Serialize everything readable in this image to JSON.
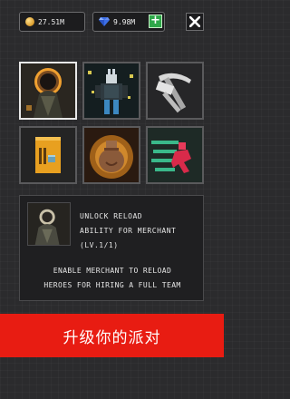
{
  "currency": {
    "coins": "27.51M",
    "gems": "9.98M",
    "add_gems_label": "+",
    "coin_color": "#e2a332",
    "gem_color": "#3d6fe6"
  },
  "upgrade": {
    "title": "UNLOCK RELOAD\nABILITY FOR MERCHANT\n(LV.1/1)",
    "description": "ENABLE MERCHANT TO RELOAD\nHEROES FOR HIRING A FULL TEAM"
  },
  "tiles": [
    {
      "icon": "merchant-icon"
    },
    {
      "icon": "hero-icon"
    },
    {
      "icon": "hammer-pickaxe-icon"
    },
    {
      "icon": "document-icon"
    },
    {
      "icon": "loot-bag-icon"
    },
    {
      "icon": "runner-icon"
    }
  ],
  "banner": {
    "text": "升级你的派对",
    "color": "#e81c12"
  }
}
